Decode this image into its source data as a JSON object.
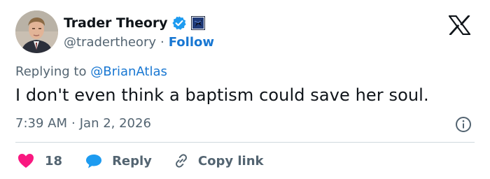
{
  "user": {
    "display_name": "Trader Theory",
    "handle": "@tradertheory",
    "separator": "·",
    "follow_label": "Follow",
    "verified_color": "#1d9bf0",
    "affiliation_badge": "eagle-badge-icon"
  },
  "tweet": {
    "replying_prefix": "Replying to",
    "replying_to": "@BrianAtlas",
    "text": "I don't even think a baptism could save her soul.",
    "time": "7:39 AM",
    "separator": "·",
    "date": "Jan 2, 2026"
  },
  "actions": {
    "like_count": "18",
    "reply_label": "Reply",
    "copy_link_label": "Copy link",
    "like_color": "#f91880",
    "reply_color": "#1d9bf0"
  },
  "icons": {
    "platform_logo": "x-logo-icon",
    "info": "info-icon",
    "like": "heart-icon",
    "reply": "speech-bubble-icon",
    "copy": "link-icon"
  }
}
